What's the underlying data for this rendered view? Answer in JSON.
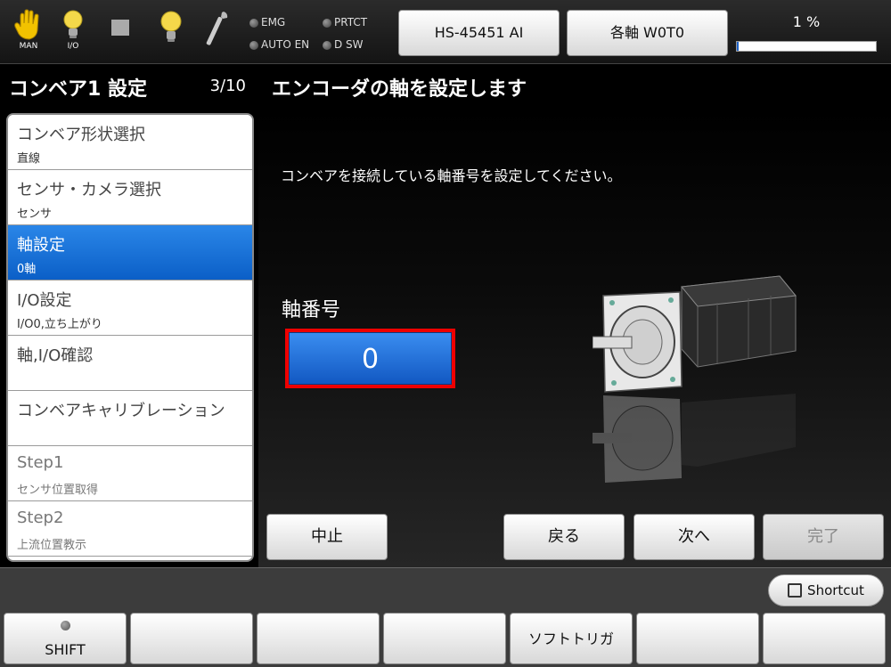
{
  "topbar": {
    "icons": [
      {
        "name": "man-hand-icon",
        "caption": "MAN"
      },
      {
        "name": "io-bulb-icon",
        "caption": "I/O"
      },
      {
        "name": "stop-square-icon",
        "caption": ""
      },
      {
        "name": "bulb-icon",
        "caption": ""
      },
      {
        "name": "wrench-icon",
        "caption": ""
      }
    ],
    "lamps": {
      "emg": "EMG",
      "prtct": "PRTCT",
      "auto_en": "AUTO EN",
      "d_sw": "D SW"
    },
    "robot_button": "HS-45451 AI",
    "axes_button": "各軸 W0T0",
    "override": {
      "text": "1 %",
      "value": 1
    }
  },
  "header": {
    "section_title": "コンベア1 設定",
    "page": "3/10",
    "page_title": "エンコーダの軸を設定します"
  },
  "steps": [
    {
      "name": "コンベア形状選択",
      "sub": "直線",
      "state": "normal"
    },
    {
      "name": "センサ・カメラ選択",
      "sub": "センサ",
      "state": "normal"
    },
    {
      "name": "軸設定",
      "sub": "0軸",
      "state": "active"
    },
    {
      "name": "I/O設定",
      "sub": "I/O0,立ち上がり",
      "state": "normal"
    },
    {
      "name": "軸,I/O確認",
      "sub": "",
      "state": "normal"
    },
    {
      "name": "コンベアキャリブレーション",
      "sub": "",
      "state": "normal"
    },
    {
      "name": "Step1",
      "sub": "センサ位置取得",
      "state": "dim"
    },
    {
      "name": "Step2",
      "sub": "上流位置教示",
      "state": "dim"
    }
  ],
  "main": {
    "instruction": "コンベアを接続している軸番号を設定してください。",
    "axis_label": "軸番号",
    "axis_value": "0"
  },
  "nav": {
    "abort": "中止",
    "back": "戻る",
    "next": "次へ",
    "finish": "完了"
  },
  "bottom": {
    "shortcut": "Shortcut",
    "fkeys": [
      "SHIFT",
      "",
      "",
      "",
      "ソフトトリガ",
      "",
      ""
    ]
  },
  "colors": {
    "accent_blue": "#1e63c8",
    "highlight_red": "#e00000"
  }
}
